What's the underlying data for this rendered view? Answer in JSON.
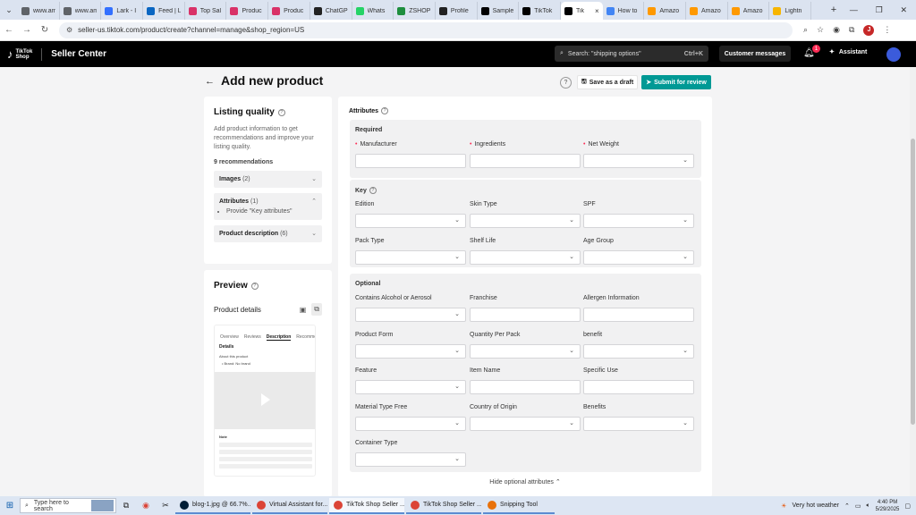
{
  "browser": {
    "tabs": [
      {
        "label": "www.am",
        "color": "#5f6368",
        "active": false
      },
      {
        "label": "www.am",
        "color": "#5f6368",
        "active": false
      },
      {
        "label": "Lark - I",
        "color": "#3370ff",
        "active": false
      },
      {
        "label": "Feed | L",
        "color": "#0a66c2",
        "active": false
      },
      {
        "label": "Top Sal",
        "color": "#d93268",
        "active": false
      },
      {
        "label": "Produc",
        "color": "#d93268",
        "active": false
      },
      {
        "label": "Produc",
        "color": "#d93268",
        "active": false
      },
      {
        "label": "ChatGP",
        "color": "#222222",
        "active": false
      },
      {
        "label": "Whats",
        "color": "#25d366",
        "active": false
      },
      {
        "label": "ZSHOP",
        "color": "#1e8e3e",
        "active": false
      },
      {
        "label": "Profile",
        "color": "#222222",
        "active": false
      },
      {
        "label": "Sample",
        "color": "#000000",
        "active": false
      },
      {
        "label": "TikTok",
        "color": "#000000",
        "active": false
      },
      {
        "label": "Tik",
        "color": "#000000",
        "active": true
      },
      {
        "label": "How to",
        "color": "#4285f4",
        "active": false
      },
      {
        "label": "Amazo",
        "color": "#ff9900",
        "active": false
      },
      {
        "label": "Amazo",
        "color": "#ff9900",
        "active": false
      },
      {
        "label": "Amazo",
        "color": "#ff9900",
        "active": false
      },
      {
        "label": "Lightn",
        "color": "#f7b500",
        "active": false
      }
    ],
    "active_tab_close": "×",
    "new_tab": "+",
    "url": "seller-us.tiktok.com/product/create?channel=manage&shop_region=US",
    "profile_initial": "J"
  },
  "header": {
    "logo_line1": "TikTok",
    "logo_line2": "Shop",
    "title": "Seller Center",
    "search_placeholder": "Search: \"shipping options\"",
    "search_shortcut": "Ctrl+K",
    "customer_messages": "Customer messages",
    "notification_count": "1",
    "assistant": "Assistant"
  },
  "page": {
    "title": "Add new product",
    "save_draft": "Save as a draft",
    "submit": "Submit for review"
  },
  "listing_quality": {
    "title": "Listing quality",
    "description": "Add product information to get recommendations and improve your listing quality.",
    "recommendations": "9 recommendations",
    "images": {
      "label": "Images",
      "count": "(2)"
    },
    "attributes": {
      "label": "Attributes",
      "count": "(1)",
      "tip": "Provide \"Key attributes\""
    },
    "product_description": {
      "label": "Product description",
      "count": "(6)"
    }
  },
  "preview": {
    "title": "Preview",
    "product_details": "Product details",
    "phone_tabs": [
      "Overview",
      "Reviews",
      "Description",
      "Recommen"
    ],
    "details_label": "Details",
    "about": "About this product",
    "brand": "Brand: No brand",
    "note": "Note"
  },
  "attributes": {
    "title": "Attributes",
    "required": {
      "title": "Required",
      "fields": [
        {
          "label": "Manufacturer",
          "type": "text"
        },
        {
          "label": "Ingredients",
          "type": "text"
        },
        {
          "label": "Net Weight",
          "type": "select"
        }
      ]
    },
    "key": {
      "title": "Key",
      "fields": [
        {
          "label": "Edition",
          "type": "select"
        },
        {
          "label": "Skin Type",
          "type": "select"
        },
        {
          "label": "SPF",
          "type": "select"
        },
        {
          "label": "Pack Type",
          "type": "select"
        },
        {
          "label": "Shelf Life",
          "type": "select"
        },
        {
          "label": "Age Group",
          "type": "select"
        }
      ]
    },
    "optional": {
      "title": "Optional",
      "fields": [
        {
          "label": "Contains Alcohol or Aerosol",
          "type": "select"
        },
        {
          "label": "Franchise",
          "type": "text"
        },
        {
          "label": "Allergen Information",
          "type": "text"
        },
        {
          "label": "Product Form",
          "type": "select"
        },
        {
          "label": "Quantity Per Pack",
          "type": "select"
        },
        {
          "label": "benefit",
          "type": "select"
        },
        {
          "label": "Feature",
          "type": "select"
        },
        {
          "label": "Item Name",
          "type": "text"
        },
        {
          "label": "Specific Use",
          "type": "text"
        },
        {
          "label": "Material Type Free",
          "type": "select"
        },
        {
          "label": "Country of Origin",
          "type": "select"
        },
        {
          "label": "Benefits",
          "type": "select"
        },
        {
          "label": "Container Type",
          "type": "select"
        }
      ]
    },
    "hide_optional": "Hide optional attributes"
  },
  "taskbar": {
    "search_placeholder": "Type here to search",
    "apps": [
      {
        "label": "blog-1.jpg @ 66.7%...",
        "color": "#001e36",
        "active": false
      },
      {
        "label": "Virtual Assistant for...",
        "color": "#db4437",
        "active": false
      },
      {
        "label": "TikTok Shop Seller ...",
        "color": "#db4437",
        "active": true
      },
      {
        "label": "TikTok Shop Seller ...",
        "color": "#db4437",
        "active": false
      },
      {
        "label": "Snipping Tool",
        "color": "#e8710a",
        "active": false
      }
    ],
    "weather": "Very hot weather",
    "time": "4:40 PM",
    "date": "5/29/2025"
  },
  "colors": {
    "accent": "#009995",
    "required_mark": "#fe2c55"
  }
}
